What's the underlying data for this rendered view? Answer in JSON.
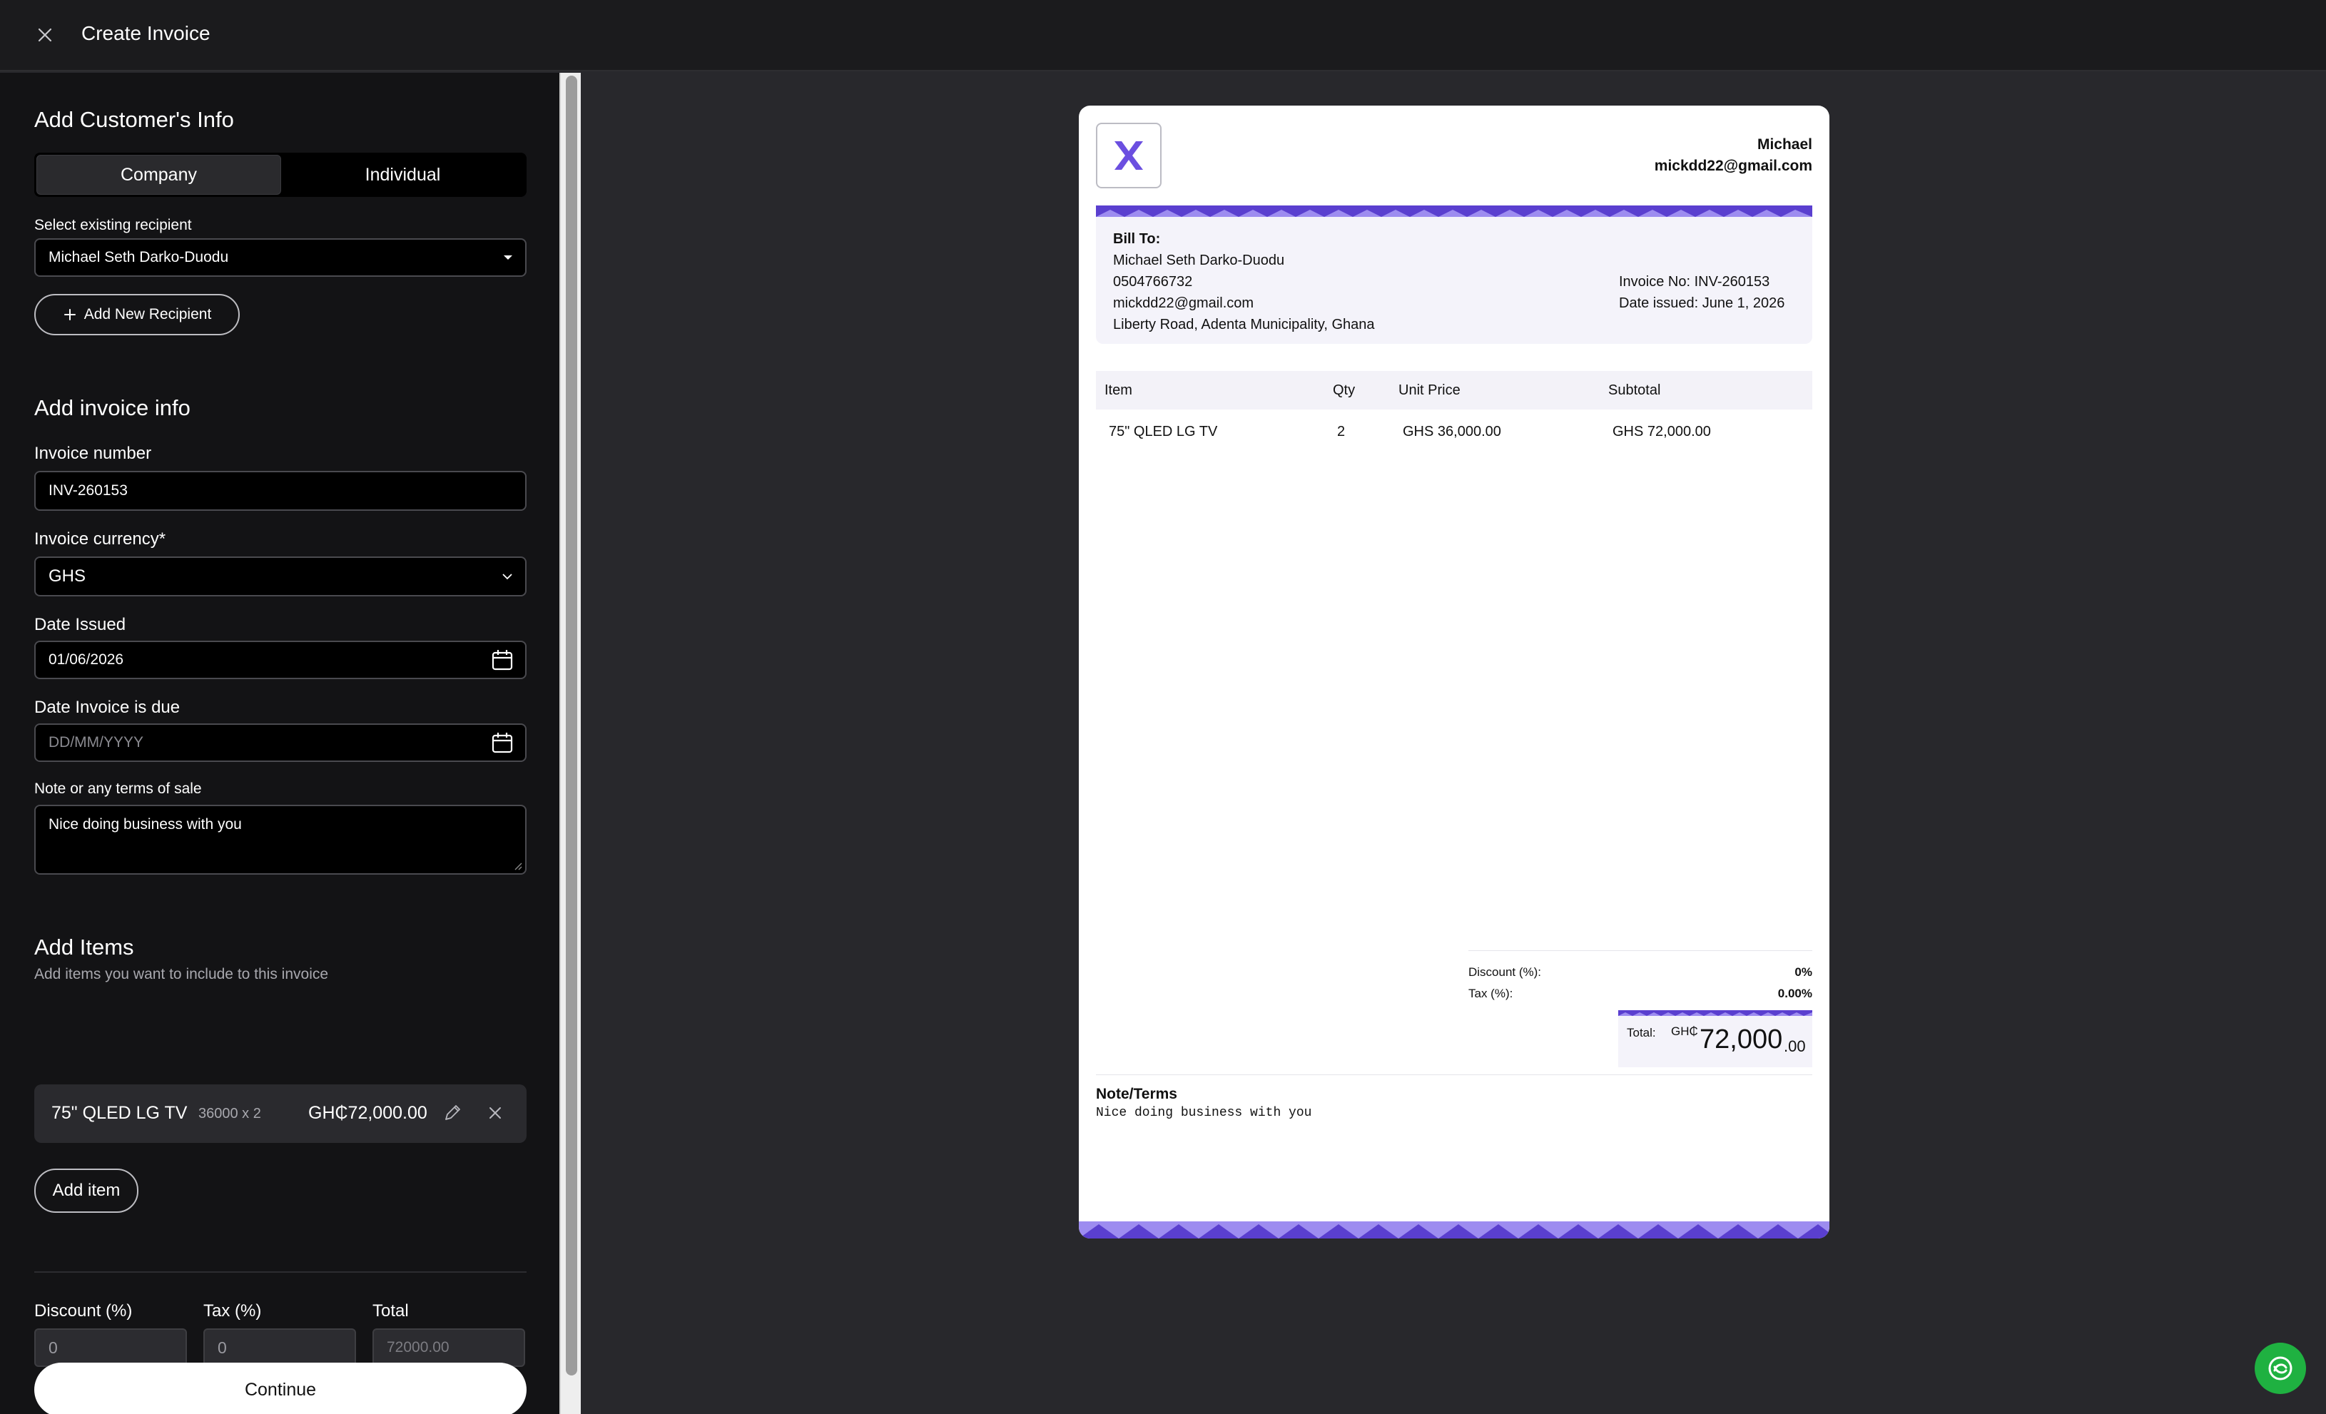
{
  "topbar": {
    "title": "Create Invoice"
  },
  "customer": {
    "heading": "Add Customer's Info",
    "tabs": [
      "Company",
      "Individual"
    ],
    "recipient_label": "Select existing recipient",
    "recipient_value": "Michael Seth Darko-Duodu",
    "add_recipient": "Add New Recipient"
  },
  "invoice_info": {
    "heading": "Add invoice info",
    "number_label": "Invoice number",
    "number_value": "INV-260153",
    "currency_label": "Invoice currency*",
    "currency_value": "GHS",
    "issued_label": "Date Issued",
    "issued_value": "01/06/2026",
    "due_label": "Date Invoice is due",
    "due_placeholder": "DD/MM/YYYY",
    "note_label": "Note or any terms of sale",
    "note_value": "Nice doing business with you"
  },
  "items_section": {
    "heading": "Add Items",
    "subheading": "Add items you want to include to this invoice",
    "items": [
      {
        "name": "75\" QLED LG TV",
        "detail": "36000 x 2",
        "amount": "GH₵72,000.00"
      }
    ],
    "add_item": "Add item"
  },
  "totals_form": {
    "discount_label": "Discount (%)",
    "discount_value": "0",
    "tax_label": "Tax (%)",
    "tax_value": "0",
    "total_label": "Total",
    "total_value": "72000.00"
  },
  "continue_label": "Continue",
  "preview": {
    "sender_name": "Michael",
    "sender_email": "mickdd22@gmail.com",
    "bill_to_label": "Bill To:",
    "bill_to": {
      "name": "Michael Seth Darko-Duodu",
      "phone": "0504766732",
      "email": "mickdd22@gmail.com",
      "address": "Liberty Road, Adenta Municipality, Ghana"
    },
    "invoice_no": "Invoice No: INV-260153",
    "date_issued": "Date issued: June 1, 2026",
    "columns": [
      "Item",
      "Qty",
      "Unit Price",
      "Subtotal"
    ],
    "rows": [
      {
        "item": "75\" QLED LG TV",
        "qty": "2",
        "unit_price": "GHS 36,000.00",
        "subtotal": "GHS 72,000.00"
      }
    ],
    "discount_label": "Discount (%):",
    "discount_value": "0%",
    "tax_label": "Tax (%):",
    "tax_value": "0.00%",
    "total_label": "Total:",
    "total_currency": "GH₵",
    "total_main": "72,000",
    "total_decimals": ".00",
    "note_heading": "Note/Terms",
    "note_text": "Nice doing business with you"
  },
  "colors": {
    "accent_purple": "#6b4fe0",
    "fab_green": "#1fb141"
  }
}
